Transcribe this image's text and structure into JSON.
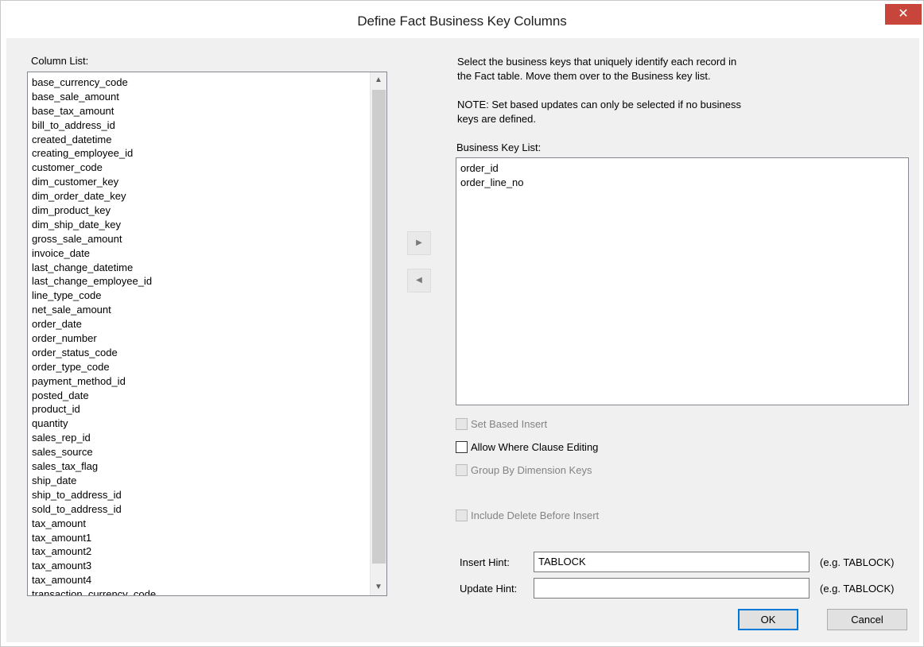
{
  "dialog": {
    "title": "Define Fact Business Key Columns",
    "close_glyph": "✕",
    "accent_color": "#c7453a"
  },
  "column_list": {
    "label": "Column List:",
    "items": [
      "base_currency_code",
      "base_sale_amount",
      "base_tax_amount",
      "bill_to_address_id",
      "created_datetime",
      "creating_employee_id",
      "customer_code",
      "dim_customer_key",
      "dim_order_date_key",
      "dim_product_key",
      "dim_ship_date_key",
      "gross_sale_amount",
      "invoice_date",
      "last_change_datetime",
      "last_change_employee_id",
      "line_type_code",
      "net_sale_amount",
      "order_date",
      "order_number",
      "order_status_code",
      "order_type_code",
      "payment_method_id",
      "posted_date",
      "product_id",
      "quantity",
      "sales_rep_id",
      "sales_source",
      "sales_tax_flag",
      "ship_date",
      "ship_to_address_id",
      "sold_to_address_id",
      "tax_amount",
      "tax_amount1",
      "tax_amount2",
      "tax_amount3",
      "tax_amount4",
      "transaction_currency_code"
    ]
  },
  "instructions": {
    "line1": "Select the business keys that uniquely identify each record in",
    "line2": "the Fact table. Move them over to the Business key list.",
    "note1": "NOTE: Set based updates can only be selected if no business",
    "note2": "keys are defined."
  },
  "business_key_list": {
    "label": "Business Key List:",
    "items": [
      "order_id",
      "order_line_no"
    ]
  },
  "move_buttons": {
    "add_glyph": "▶",
    "remove_glyph": "◀"
  },
  "options": {
    "set_based_insert": {
      "label": "Set Based Insert",
      "checked": false,
      "enabled": false
    },
    "allow_where_clause_editing": {
      "label": "Allow Where Clause Editing",
      "checked": false,
      "enabled": true
    },
    "group_by_dimension_keys": {
      "label": "Group By Dimension Keys",
      "checked": false,
      "enabled": false
    },
    "include_delete_before_insert": {
      "label": "Include Delete Before Insert",
      "checked": false,
      "enabled": false
    }
  },
  "hints": {
    "insert_label": "Insert Hint:",
    "insert_value": "TABLOCK",
    "insert_example": "(e.g. TABLOCK)",
    "update_label": "Update Hint:",
    "update_value": "",
    "update_example": "(e.g. TABLOCK)"
  },
  "buttons": {
    "ok": "OK",
    "cancel": "Cancel"
  },
  "scrollbar": {
    "up_glyph": "▲",
    "down_glyph": "▼"
  }
}
